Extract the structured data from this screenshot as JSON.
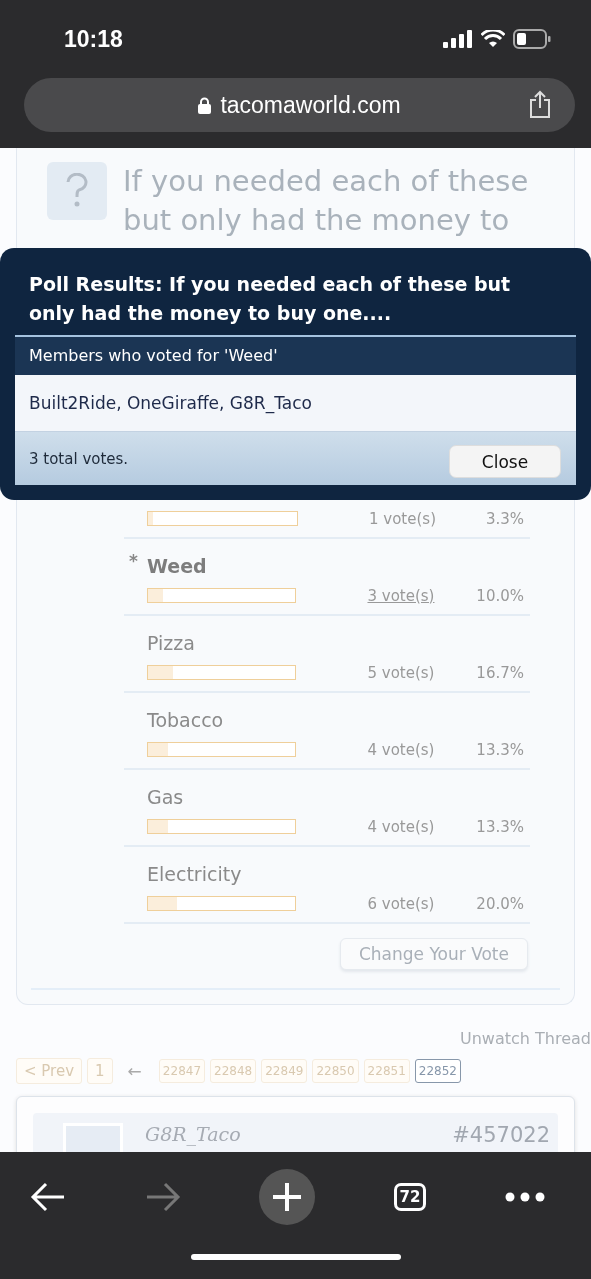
{
  "status_bar": {
    "time": "10:18"
  },
  "address_bar": {
    "url": "tacomaworld.com"
  },
  "poll": {
    "question": "If you needed each of these but only had the money to",
    "voted_marker": "*",
    "options": [
      {
        "votes": "1 vote(s)",
        "percent": "3.3%",
        "level": 0.033,
        "selected": false
      },
      {
        "name": "Weed",
        "votes": "3 vote(s)",
        "percent": "10.0%",
        "level": 0.1,
        "voted": true,
        "selected": true
      },
      {
        "name": "Pizza",
        "votes": "5 vote(s)",
        "percent": "16.7%",
        "level": 0.167,
        "voted": false,
        "selected": false
      },
      {
        "name": "Tobacco",
        "votes": "4 vote(s)",
        "percent": "13.3%",
        "level": 0.133,
        "voted": false,
        "selected": false
      },
      {
        "name": "Gas",
        "votes": "4 vote(s)",
        "percent": "13.3%",
        "level": 0.133,
        "voted": false,
        "selected": false
      },
      {
        "name": "Electricity",
        "votes": "6 vote(s)",
        "percent": "20.0%",
        "level": 0.2,
        "voted": false,
        "selected": false
      }
    ],
    "change_vote_button": "Change Your Vote"
  },
  "unwatch_link": "Unwatch Thread",
  "pagination": {
    "prev": "< Prev",
    "first": "1",
    "jump": "←",
    "pages": [
      {
        "label": "22847",
        "selected": false
      },
      {
        "label": "22848",
        "selected": false
      },
      {
        "label": "22849",
        "selected": false
      },
      {
        "label": "22850",
        "selected": false
      },
      {
        "label": "22851",
        "selected": false
      },
      {
        "label": "22852",
        "selected": true
      }
    ]
  },
  "post": {
    "author": "G8R_Taco",
    "number": "#457022"
  },
  "popup": {
    "title": "Poll Results: If you needed each of these but only had the money to buy one....",
    "subheading": "Members who voted for 'Weed'",
    "members": "Built2Ride, OneGiraffe, G8R_Taco",
    "total": "3 total votes.",
    "close_button": "Close"
  },
  "toolbar": {
    "tab_count": "72",
    "forward_disabled": true
  }
}
